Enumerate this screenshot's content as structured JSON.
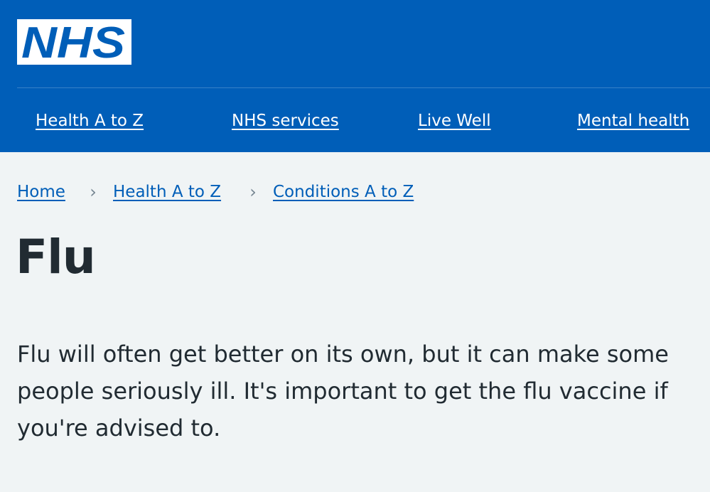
{
  "header": {
    "logo_text": "NHS",
    "colors": {
      "brand_blue": "#005eb8",
      "white": "#ffffff"
    },
    "nav": [
      {
        "label": "Health A to Z"
      },
      {
        "label": "NHS services"
      },
      {
        "label": "Live Well"
      },
      {
        "label": "Mental health"
      }
    ]
  },
  "breadcrumb": {
    "items": [
      {
        "label": "Home"
      },
      {
        "label": "Health A to Z"
      },
      {
        "label": "Conditions A to Z"
      }
    ],
    "separator_icon": "chevron-right-icon",
    "separator_glyph": "›"
  },
  "main": {
    "title": "Flu",
    "lede": "Flu will often get better on its own, but it can make some people seriously ill. It's important to get the flu vaccine if you're advised to."
  }
}
